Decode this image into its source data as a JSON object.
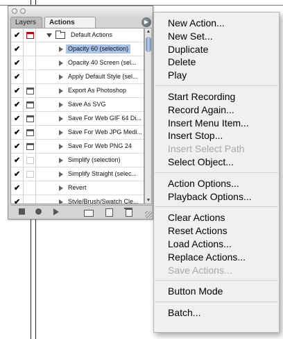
{
  "palette": {
    "tabs": [
      {
        "label": "Layers",
        "active": false
      },
      {
        "label": "Actions",
        "active": true
      }
    ],
    "menu_button_icon": "palette-menu-arrow-icon",
    "set_name": "Default Actions",
    "actions": [
      {
        "label": "Opacity 60 (selection)",
        "checked": true,
        "dialog": "none",
        "selected": true
      },
      {
        "label": "Opacity 40 Screen (sel...",
        "checked": true,
        "dialog": "none",
        "selected": false
      },
      {
        "label": "Apply Default Style (sel...",
        "checked": true,
        "dialog": "none",
        "selected": false
      },
      {
        "label": "Export As Photoshop",
        "checked": true,
        "dialog": "on",
        "selected": false
      },
      {
        "label": "Save As SVG",
        "checked": true,
        "dialog": "on",
        "selected": false
      },
      {
        "label": "Save For Web GIF 64 Di...",
        "checked": true,
        "dialog": "on",
        "selected": false
      },
      {
        "label": "Save For Web JPG Medi...",
        "checked": true,
        "dialog": "on",
        "selected": false
      },
      {
        "label": "Save For Web PNG 24",
        "checked": true,
        "dialog": "on",
        "selected": false
      },
      {
        "label": "Simplify (selection)",
        "checked": true,
        "dialog": "empty",
        "selected": false
      },
      {
        "label": "Simplify Straight (selec...",
        "checked": true,
        "dialog": "empty",
        "selected": false
      },
      {
        "label": "Revert",
        "checked": true,
        "dialog": "none",
        "selected": false
      },
      {
        "label": "Style/Brush/Swatch Cle...",
        "checked": true,
        "dialog": "none",
        "selected": false
      }
    ],
    "bottom_buttons": [
      "stop-icon",
      "record-icon",
      "play-icon",
      "new-set-icon",
      "new-action-icon",
      "trash-icon"
    ],
    "check_glyph": "✔",
    "colors": {
      "selection": "#a9c4e8",
      "dialog_red": "#c20000"
    }
  },
  "menu": {
    "groups": [
      [
        {
          "label": "New Action...",
          "enabled": true
        },
        {
          "label": "New Set...",
          "enabled": true
        },
        {
          "label": "Duplicate",
          "enabled": true
        },
        {
          "label": "Delete",
          "enabled": true
        },
        {
          "label": "Play",
          "enabled": true
        }
      ],
      [
        {
          "label": "Start Recording",
          "enabled": true
        },
        {
          "label": "Record Again...",
          "enabled": true
        },
        {
          "label": "Insert Menu Item...",
          "enabled": true
        },
        {
          "label": "Insert Stop...",
          "enabled": true
        },
        {
          "label": "Insert Select Path",
          "enabled": false
        },
        {
          "label": "Select Object...",
          "enabled": true
        }
      ],
      [
        {
          "label": "Action Options...",
          "enabled": true
        },
        {
          "label": "Playback Options...",
          "enabled": true
        }
      ],
      [
        {
          "label": "Clear Actions",
          "enabled": true
        },
        {
          "label": "Reset Actions",
          "enabled": true
        },
        {
          "label": "Load Actions...",
          "enabled": true
        },
        {
          "label": "Replace Actions...",
          "enabled": true
        },
        {
          "label": "Save Actions...",
          "enabled": false
        }
      ],
      [
        {
          "label": "Button Mode",
          "enabled": true
        }
      ],
      [
        {
          "label": "Batch...",
          "enabled": true
        }
      ]
    ]
  }
}
